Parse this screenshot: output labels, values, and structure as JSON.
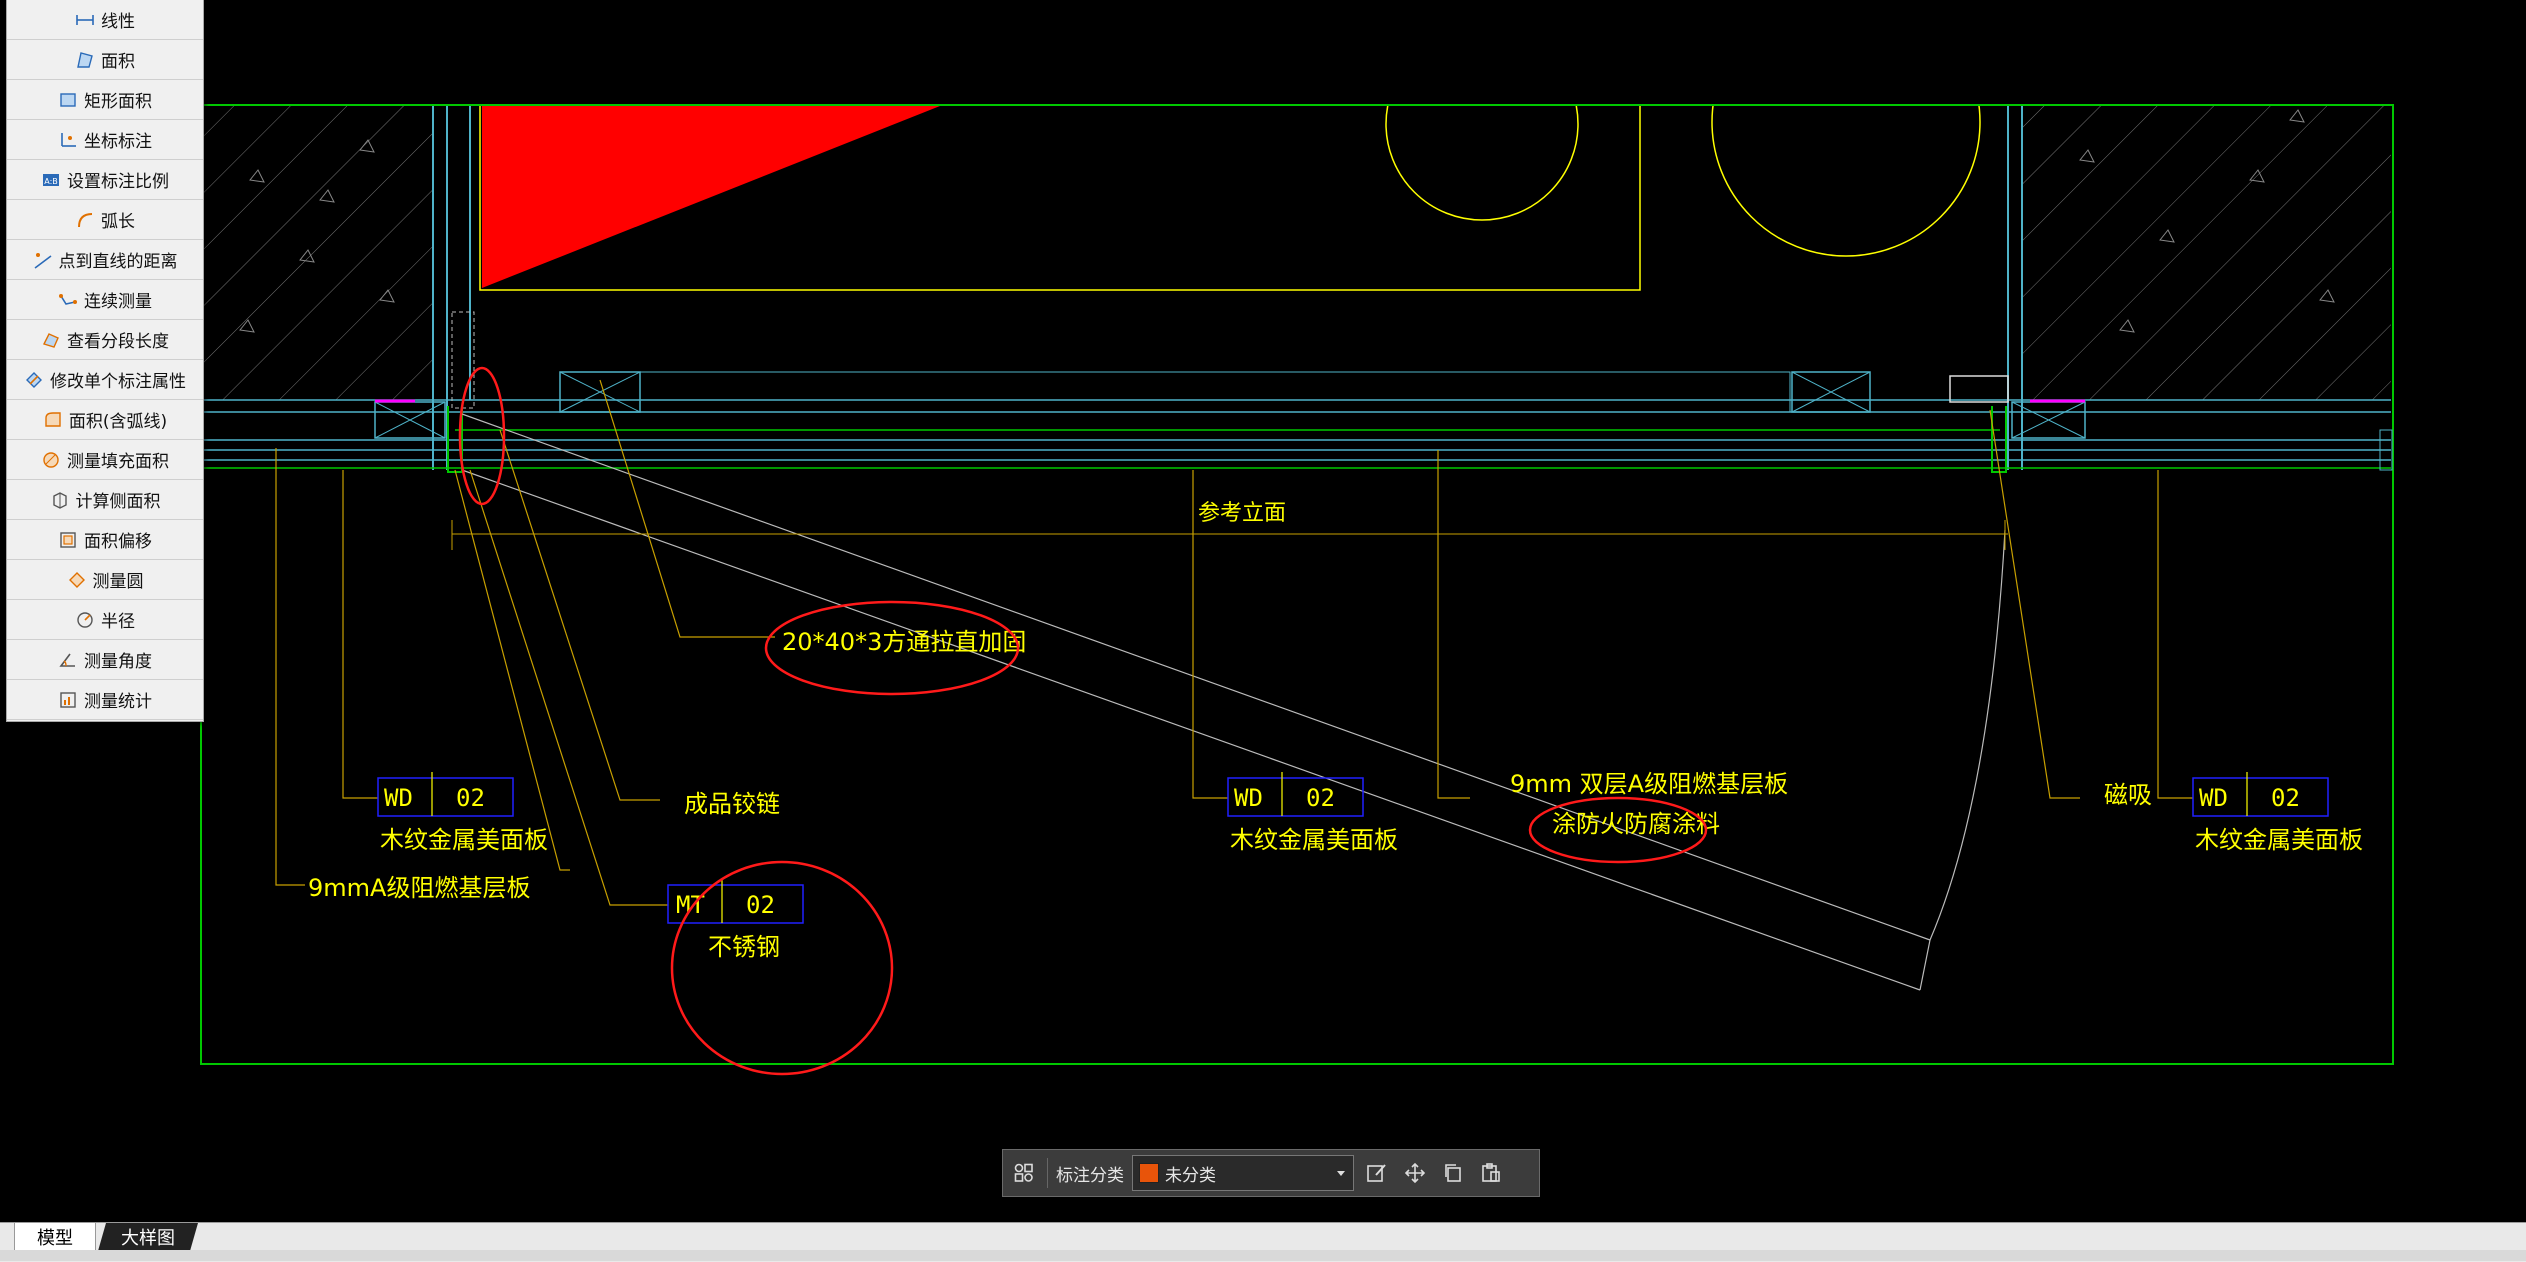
{
  "measure_tools": [
    {
      "label": "线性",
      "icon": "linear-dim-icon"
    },
    {
      "label": "面积",
      "icon": "area-icon"
    },
    {
      "label": "矩形面积",
      "icon": "rect-area-icon"
    },
    {
      "label": "坐标标注",
      "icon": "coordinate-icon"
    },
    {
      "label": "设置标注比例",
      "icon": "scale-icon"
    },
    {
      "label": "弧长",
      "icon": "arc-length-icon"
    },
    {
      "label": "点到直线的距离",
      "icon": "point-line-distance-icon"
    },
    {
      "label": "连续测量",
      "icon": "continuous-measure-icon"
    },
    {
      "label": "查看分段长度",
      "icon": "segment-length-icon"
    },
    {
      "label": "修改单个标注属性",
      "icon": "edit-annotation-icon"
    },
    {
      "label": "面积(含弧线)",
      "icon": "arc-area-icon"
    },
    {
      "label": "测量填充面积",
      "icon": "hatch-area-icon"
    },
    {
      "label": "计算侧面积",
      "icon": "side-area-icon"
    },
    {
      "label": "面积偏移",
      "icon": "area-offset-icon"
    },
    {
      "label": "测量圆",
      "icon": "circle-measure-icon"
    },
    {
      "label": "半径",
      "icon": "radius-icon"
    },
    {
      "label": "测量角度",
      "icon": "angle-icon"
    },
    {
      "label": "测量统计",
      "icon": "statistics-icon"
    }
  ],
  "drawing": {
    "ref_elevation": "参考立面",
    "square_tube": "20*40*3方通拉直加固",
    "hinge": "成品铰链",
    "board_9mm": "9mmA级阻燃基层板",
    "double_board_line1": "9mm  双层A级阻燃基层板",
    "double_board_line2": "涂防火防腐涂料",
    "magnet": "磁吸",
    "tag_left": {
      "code": "WD",
      "num": "02",
      "desc": "木纹金属美面板"
    },
    "tag_mid": {
      "code": "WD",
      "num": "02",
      "desc": "木纹金属美面板"
    },
    "tag_right": {
      "code": "WD",
      "num": "02",
      "desc": "木纹金属美面板"
    },
    "tag_mt": {
      "code": "MT",
      "num": "02",
      "desc": "不锈钢"
    }
  },
  "colors": {
    "cad_yellow": "#ffff00",
    "cad_green": "#00c800",
    "cad_cyan": "#4fb3c9",
    "cad_blue": "#2020ff",
    "leader": "#c8a000",
    "markup_red": "#ff1a1a",
    "fill_red": "#ff0000",
    "swatch": "#e8540a"
  },
  "annotation_bar": {
    "category_label": "标注分类",
    "selected_category": "未分类"
  },
  "tabs": [
    {
      "label": "模型"
    },
    {
      "label": "大样图"
    }
  ]
}
